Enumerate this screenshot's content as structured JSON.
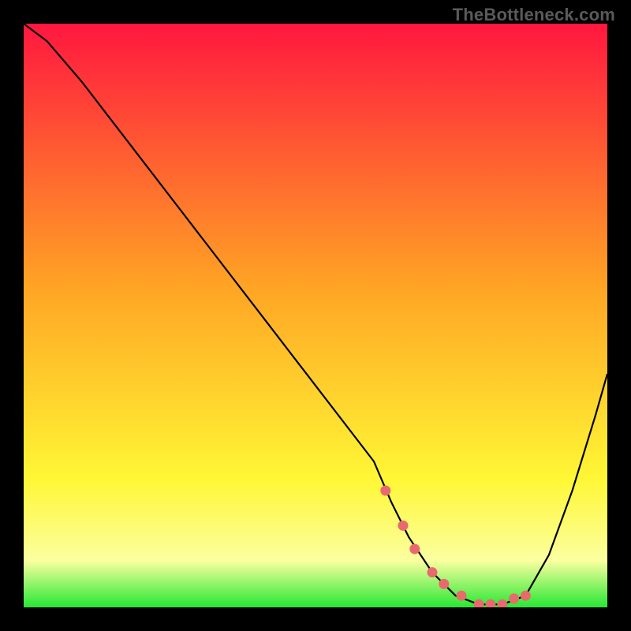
{
  "watermark": "TheBottleneck.com",
  "colors": {
    "gradient": [
      {
        "offset": "0%",
        "hex": "#ff173f"
      },
      {
        "offset": "45%",
        "hex": "#ffa424"
      },
      {
        "offset": "78%",
        "hex": "#fff735"
      },
      {
        "offset": "92%",
        "hex": "#fbffa0"
      },
      {
        "offset": "100%",
        "hex": "#27e833"
      }
    ],
    "curve": "#000000",
    "marker": "#e96a6d"
  },
  "chart_data": {
    "type": "line",
    "title": "",
    "xlabel": "",
    "ylabel": "",
    "xlim": [
      0,
      100
    ],
    "ylim": [
      0,
      100
    ],
    "series": [
      {
        "name": "curve",
        "x": [
          0,
          4,
          10,
          20,
          30,
          40,
          50,
          60,
          63,
          66,
          70,
          74,
          78,
          82,
          86,
          90,
          94,
          98,
          100
        ],
        "values": [
          100,
          97,
          90,
          77,
          64,
          51,
          38,
          25,
          18,
          12,
          6,
          2,
          0.5,
          0.5,
          2,
          9,
          20,
          33,
          40
        ]
      }
    ],
    "highlighted_points": {
      "x": [
        62,
        65,
        67,
        70,
        72,
        75,
        78,
        80,
        82,
        84,
        86
      ],
      "values": [
        20,
        14,
        10,
        6,
        4,
        2,
        0.5,
        0.5,
        0.5,
        1.5,
        2
      ]
    }
  }
}
